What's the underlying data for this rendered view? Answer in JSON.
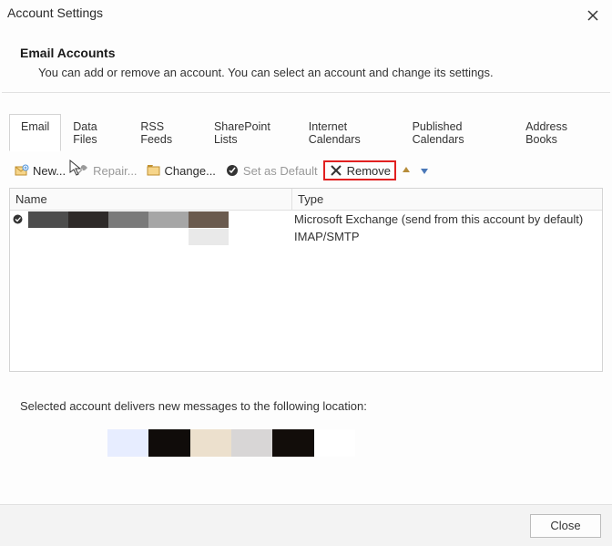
{
  "dialog": {
    "title": "Account Settings",
    "heading": "Email Accounts",
    "description": "You can add or remove an account. You can select an account and change its settings."
  },
  "tabs": [
    {
      "id": "email",
      "label": "Email",
      "active": true
    },
    {
      "id": "data-files",
      "label": "Data Files",
      "active": false
    },
    {
      "id": "rss-feeds",
      "label": "RSS Feeds",
      "active": false
    },
    {
      "id": "sharepoint-lists",
      "label": "SharePoint Lists",
      "active": false
    },
    {
      "id": "internet-calendars",
      "label": "Internet Calendars",
      "active": false
    },
    {
      "id": "published-calendars",
      "label": "Published Calendars",
      "active": false
    },
    {
      "id": "address-books",
      "label": "Address Books",
      "active": false
    }
  ],
  "toolbar": {
    "new": "New...",
    "repair": "Repair...",
    "change": "Change...",
    "set_default": "Set as Default",
    "remove": "Remove"
  },
  "grid": {
    "columns": {
      "name": "Name",
      "type": "Type"
    },
    "rows": [
      {
        "default": true,
        "name_redacted": true,
        "name_swatches": [
          "#4d4d4d",
          "#2e2a29",
          "#7a7a7a",
          "#a6a6a6",
          "#6a5a4e"
        ],
        "type": "Microsoft Exchange (send from this account by default)"
      },
      {
        "default": false,
        "name_redacted": true,
        "name_swatches": [
          "#ffffff",
          "#ffffff",
          "#ffffff",
          "#ffffff",
          "#e9e9e9"
        ],
        "type": "IMAP/SMTP"
      }
    ]
  },
  "delivery": {
    "label": "Selected account delivers new messages to the following location:",
    "swatches": [
      "#e7edff",
      "#100c0a",
      "#ece0cd",
      "#d8d6d6",
      "#120d0a",
      "#ffffff"
    ]
  },
  "footer": {
    "close": "Close"
  }
}
